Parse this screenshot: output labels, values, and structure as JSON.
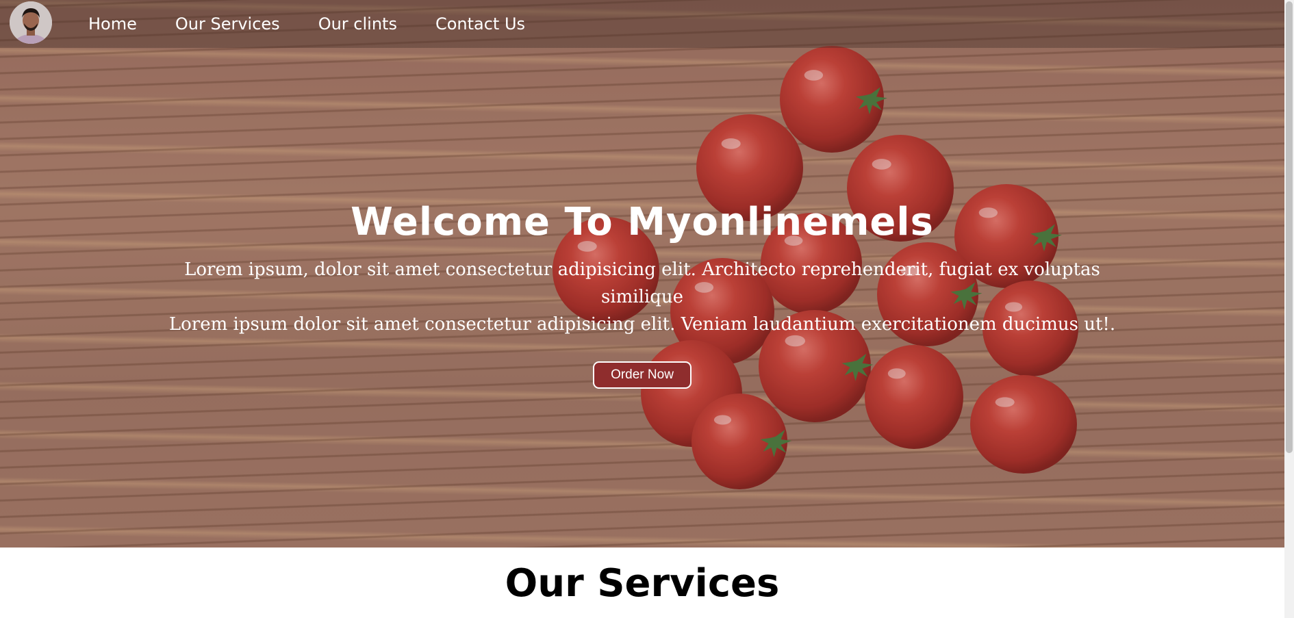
{
  "navbar": {
    "avatar_icon": "profile-photo",
    "links": [
      {
        "label": "Home"
      },
      {
        "label": "Our Services"
      },
      {
        "label": "Our clints"
      },
      {
        "label": "Contact Us"
      }
    ]
  },
  "hero": {
    "title": "Welcome To Myonlinemels",
    "line1": "Lorem ipsum, dolor sit amet consectetur adipisicing elit. Architecto reprehenderit, fugiat ex voluptas similique",
    "line2": "Lorem ipsum dolor sit amet consectetur adipisicing elit. Veniam laudantium exercitationem ducimus ut!.",
    "button_label": "Order Now",
    "colors": {
      "button_bg": "#8f2d2d",
      "tomato": "#c0392b"
    }
  },
  "services": {
    "title": "Our Services"
  }
}
